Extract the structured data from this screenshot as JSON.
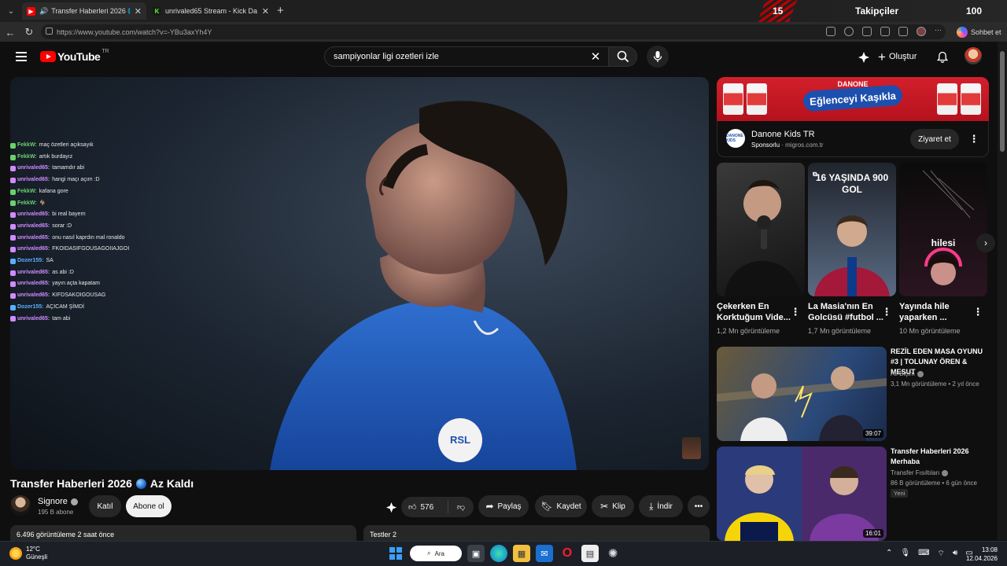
{
  "browser": {
    "tabs": [
      {
        "title": "Transfer Haberleri 2026 🌐 Az",
        "favicon_color": "#ff0000"
      },
      {
        "title": "unrivaled65 Stream - Kick Dashboar",
        "favicon_color": "#53fc18",
        "favicon_letter": "K"
      }
    ],
    "url": "https://www.youtube.com/watch?v=-YBu3axYh4Y",
    "copilot_label": "Sohbet et"
  },
  "stream_overlay": {
    "number": "15",
    "label": "Takipçiler",
    "count": "100"
  },
  "youtube": {
    "logo_text": "YouTube",
    "country": "TR",
    "search_value": "sampiyonlar ligi ozetleri izle",
    "create_label": "Oluştur"
  },
  "chat": [
    {
      "user": "FekkW:",
      "msg": "maç özetleri açıksayık",
      "color": "#6bd16b"
    },
    {
      "user": "FekkW:",
      "msg": "artık burdayız",
      "color": "#6bd16b"
    },
    {
      "user": "unrivaled65:",
      "msg": "tamamdır abi",
      "color": "#d08cff"
    },
    {
      "user": "unrivaled65:",
      "msg": "hangi maçı açım :D",
      "color": "#d08cff"
    },
    {
      "user": "FekkW:",
      "msg": "kafana gore",
      "color": "#6bd16b"
    },
    {
      "user": "FekkW:",
      "msg": "🐐",
      "color": "#6bd16b"
    },
    {
      "user": "unrivaled65:",
      "msg": "bi real bayern",
      "color": "#d08cff"
    },
    {
      "user": "unrivaled65:",
      "msg": "sorar :D",
      "color": "#d08cff"
    },
    {
      "user": "unrivaled65:",
      "msg": "onu nasıl kaprdın mal ronaldo",
      "color": "#d08cff"
    },
    {
      "user": "unrivaled65:",
      "msg": "FKOIDASIFGOUSAGOIIAJGOI",
      "color": "#d08cff"
    },
    {
      "user": "Dozer155:",
      "msg": "SA",
      "color": "#59b0ff"
    },
    {
      "user": "unrivaled65:",
      "msg": "as abi :D",
      "color": "#d08cff"
    },
    {
      "user": "unrivaled65:",
      "msg": "yayın açta kapatam",
      "color": "#d08cff"
    },
    {
      "user": "unrivaled65:",
      "msg": "KIFDSAKOIGOUSAG",
      "color": "#d08cff"
    },
    {
      "user": "Dozer155:",
      "msg": "AÇICAM ŞİMDİ",
      "color": "#59b0ff"
    },
    {
      "user": "unrivaled65:",
      "msg": "tam abi",
      "color": "#d08cff"
    }
  ],
  "video": {
    "title": "Transfer Haberleri 2026",
    "title_suffix": "Az Kaldı",
    "channel": "Signore",
    "subscribers": "195 B abone",
    "join_label": "Katıl",
    "subscribe_label": "Abone ol",
    "likes": "576",
    "share_label": "Paylaş",
    "save_label": "Kaydet",
    "clip_label": "Klip",
    "download_label": "İndir",
    "desc_meta": "6.496 görüntüleme  2 saat önce",
    "tests_label": "Testler 2",
    "jersey_badge": "RSL"
  },
  "ad": {
    "brand": "DANONE",
    "slogan": "Eğlenceyi Kaşıkla",
    "pack_label": "MİX",
    "logo_text": "DANONE KIDS",
    "advertiser": "Danone Kids TR",
    "sponsored": "Sponsorlu",
    "domain": "migros.com.tr",
    "visit_label": "Ziyaret et"
  },
  "shorts": [
    {
      "title": "Çekerken En Korktuğum Vide...",
      "views": "1,2 Mn görüntüleme",
      "overlay": ""
    },
    {
      "title": "La Masia'nın En Golcüsü #futbol ...",
      "views": "1,7 Mn görüntüleme",
      "overlay": "16 YAŞINDA 900 GOL"
    },
    {
      "title": "Yayında hile yaparken ...",
      "views": "10 Mn görüntüleme",
      "overlay": "hilesi"
    }
  ],
  "recommendations": [
    {
      "title": "REZİL EDEN MASA OYUNU #3 | TOLUNAY ÖREN & MESUT ...",
      "channel": "Ali Biçim",
      "meta": "3,1 Mn görüntüleme • 2 yıl önce",
      "duration": "39:07"
    },
    {
      "title": "Transfer Haberleri 2026 Merhaba",
      "channel": "Transfer Fısıltıları",
      "meta": "86 B görüntüleme • 6 gün önce",
      "duration": "16:01",
      "badge": "Yeni"
    }
  ],
  "taskbar": {
    "temp": "12°C",
    "condition": "Güneşli",
    "search_label": "Ara",
    "time": "13:08",
    "date": "12.04.2026"
  },
  "colors": {
    "yt_red": "#ff0000",
    "background": "#0f0f0f",
    "chip": "#272727",
    "ad_red": "#c8172a"
  }
}
